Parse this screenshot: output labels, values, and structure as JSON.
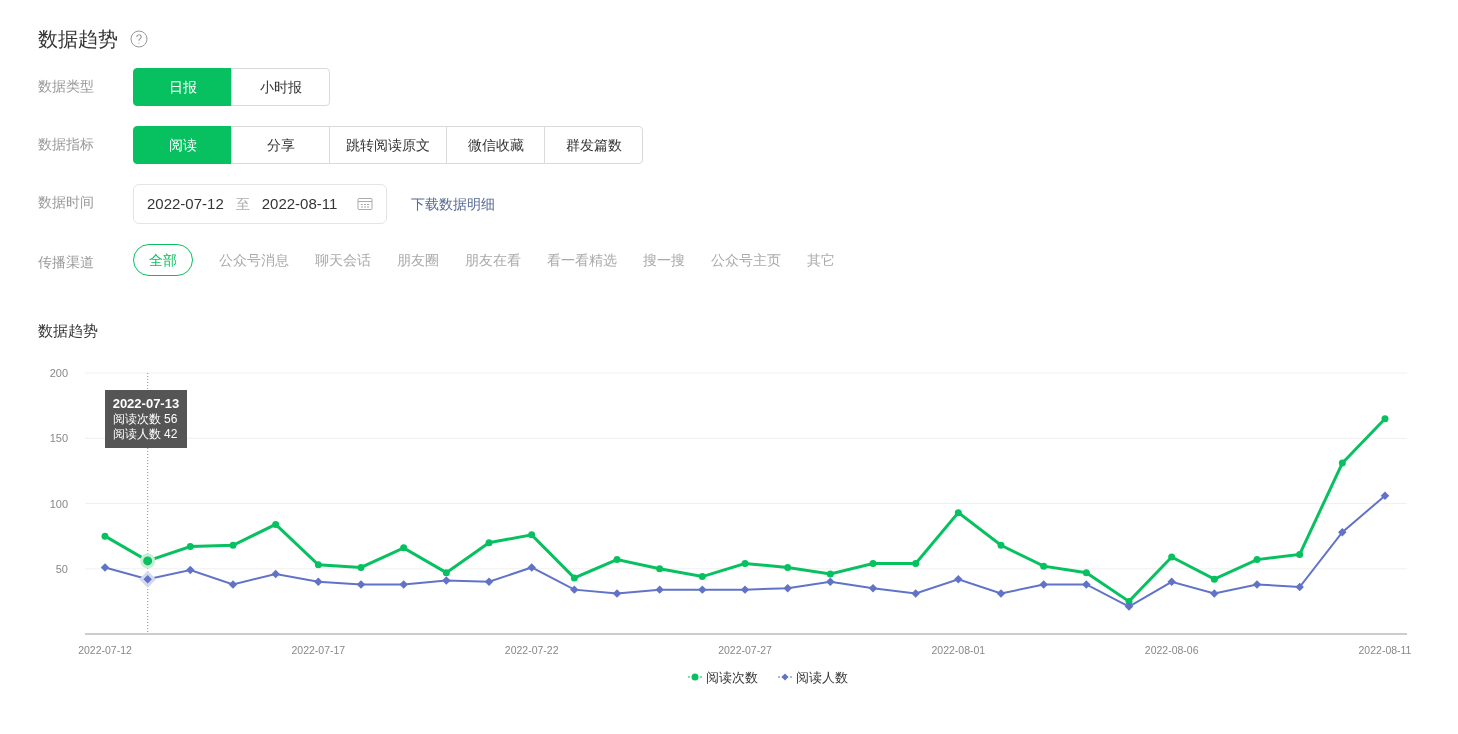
{
  "title": "数据趋势",
  "filters": [
    {
      "label": "数据类型",
      "kind": "segmented",
      "options": [
        {
          "label": "日报",
          "selected": true
        },
        {
          "label": "小时报",
          "selected": false
        }
      ]
    },
    {
      "label": "数据指标",
      "kind": "segmented",
      "options": [
        {
          "label": "阅读",
          "selected": true
        },
        {
          "label": "分享",
          "selected": false
        },
        {
          "label": "跳转阅读原文",
          "selected": false
        },
        {
          "label": "微信收藏",
          "selected": false
        },
        {
          "label": "群发篇数",
          "selected": false
        }
      ]
    },
    {
      "label": "数据时间",
      "kind": "daterange",
      "start": "2022-07-12",
      "separator": "至",
      "end": "2022-08-11",
      "link": "下载数据明细"
    },
    {
      "label": "传播渠道",
      "kind": "pills",
      "options": [
        {
          "label": "全部",
          "selected": true
        },
        {
          "label": "公众号消息",
          "selected": false
        },
        {
          "label": "聊天会话",
          "selected": false
        },
        {
          "label": "朋友圈",
          "selected": false
        },
        {
          "label": "朋友在看",
          "selected": false
        },
        {
          "label": "看一看精选",
          "selected": false
        },
        {
          "label": "搜一搜",
          "selected": false
        },
        {
          "label": "公众号主页",
          "selected": false
        },
        {
          "label": "其它",
          "selected": false
        }
      ]
    }
  ],
  "chart_heading": "数据趋势",
  "chart_data": {
    "type": "line",
    "categories": [
      "2022-07-12",
      null,
      null,
      null,
      null,
      "2022-07-17",
      null,
      null,
      null,
      null,
      "2022-07-22",
      null,
      null,
      null,
      null,
      "2022-07-27",
      null,
      null,
      null,
      null,
      "2022-08-01",
      null,
      null,
      null,
      null,
      "2022-08-06",
      null,
      null,
      null,
      null,
      "2022-08-11"
    ],
    "grid": true,
    "legend": true,
    "series": [
      {
        "name": "阅读次数",
        "color": "#07c160",
        "marker": "circle",
        "values": [
          75,
          56,
          67,
          68,
          84,
          53,
          51,
          66,
          47,
          70,
          76,
          43,
          57,
          50,
          44,
          54,
          51,
          46,
          54,
          54,
          93,
          68,
          52,
          47,
          25,
          59,
          42,
          57,
          61,
          131,
          165
        ]
      },
      {
        "name": "阅读人数",
        "color": "#6173c7",
        "marker": "diamond",
        "values": [
          51,
          42,
          49,
          38,
          46,
          40,
          38,
          38,
          41,
          40,
          51,
          34,
          31,
          34,
          34,
          34,
          35,
          40,
          35,
          31,
          42,
          31,
          38,
          38,
          21,
          40,
          31,
          38,
          36,
          78,
          106
        ]
      }
    ],
    "ylim": [
      0,
      200
    ],
    "yticks": [
      50,
      100,
      150,
      200
    ],
    "annotations": [
      "**2022-07-13**\n阅读次数 56\n阅读人数 42"
    ]
  },
  "chart_hover": [
    false,
    true,
    false,
    false,
    false,
    false,
    false,
    false,
    false,
    false,
    false,
    false,
    false,
    false,
    false,
    false,
    false,
    false,
    false,
    false,
    false,
    false,
    false,
    false,
    false,
    false,
    false,
    false,
    false,
    false,
    false
  ]
}
